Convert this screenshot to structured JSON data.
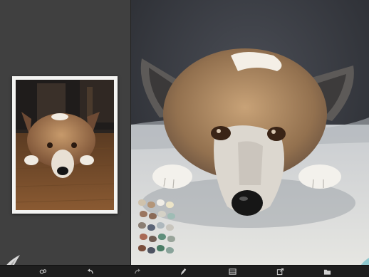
{
  "app": {
    "accent": "#8fc9cf"
  },
  "reference": {
    "icon": "reference-photo"
  },
  "palette": {
    "colors": [
      "#cfc2ac",
      "#b39578",
      "#f0ede6",
      "#ece4c7",
      "#9a7660",
      "#8a6a57",
      "#d4d1c6",
      "#9fbcb5",
      "#8b7e73",
      "#5b6476",
      "#aeb8bd",
      "#c8c5bd",
      "#a96a56",
      "#6f5c53",
      "#5f8f7c",
      "#98a49a",
      "#7a4e3c",
      "#4d5361",
      "#4b7d66",
      "#89a39a"
    ]
  },
  "toolbar": {
    "items": [
      {
        "name": "settings",
        "icon": "gear-icon"
      },
      {
        "name": "undo",
        "icon": "undo-icon"
      },
      {
        "name": "redo",
        "icon": "redo-icon"
      },
      {
        "name": "brush",
        "icon": "brush-icon"
      },
      {
        "name": "layers",
        "icon": "layers-icon"
      },
      {
        "name": "export",
        "icon": "export-icon"
      },
      {
        "name": "gallery",
        "icon": "gallery-icon"
      }
    ]
  }
}
